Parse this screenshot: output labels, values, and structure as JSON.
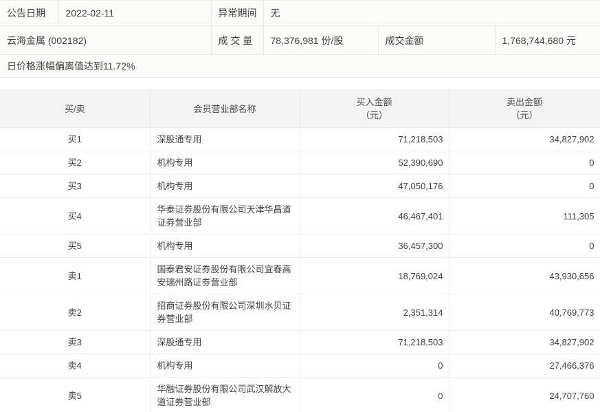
{
  "info": {
    "announce_date_label": "公告日期",
    "announce_date": "2022-02-11",
    "abnormal_period_label": "异常期间",
    "abnormal_period": "无",
    "stock_name": "云海金属 (002182)",
    "volume_label": "成 交 量",
    "volume": "78,376,981 份/股",
    "turnover_label": "成交金额",
    "turnover": "1,768,744,680 元",
    "reason": "日价格涨幅偏离值达到11.72%"
  },
  "table": {
    "columns": [
      {
        "label": "买/卖",
        "sub": ""
      },
      {
        "label": "会员营业部名称",
        "sub": ""
      },
      {
        "label": "买入金额",
        "sub": "（元）"
      },
      {
        "label": "卖出金额",
        "sub": "（元）"
      }
    ],
    "rows": [
      {
        "rank": "买1",
        "branch": "深股通专用",
        "buy": "71,218,503",
        "sell": "34,827,902"
      },
      {
        "rank": "买2",
        "branch": "机构专用",
        "buy": "52,390,690",
        "sell": "0"
      },
      {
        "rank": "买3",
        "branch": "机构专用",
        "buy": "47,050,176",
        "sell": "0"
      },
      {
        "rank": "买4",
        "branch": "华泰证券股份有限公司天津华昌道证券营业部",
        "buy": "46,467,401",
        "sell": "111,305"
      },
      {
        "rank": "买5",
        "branch": "机构专用",
        "buy": "36,457,300",
        "sell": "0"
      },
      {
        "rank": "卖1",
        "branch": "国泰君安证券股份有限公司宜春高安瑞州路证券营业部",
        "buy": "18,769,024",
        "sell": "43,930,656"
      },
      {
        "rank": "卖2",
        "branch": "招商证券股份有限公司深圳水贝证券营业部",
        "buy": "2,351,314",
        "sell": "40,769,773"
      },
      {
        "rank": "卖3",
        "branch": "深股通专用",
        "buy": "71,218,503",
        "sell": "34,827,902"
      },
      {
        "rank": "卖4",
        "branch": "机构专用",
        "buy": "0",
        "sell": "27,466,376"
      },
      {
        "rank": "卖5",
        "branch": "华融证券股份有限公司武汉解放大道证券营业部",
        "buy": "0",
        "sell": "24,707,760"
      }
    ]
  },
  "colors": {
    "header_bg": "#f4f4f5",
    "info_bg": "#fcfcfb",
    "border": "#e9e9e9",
    "text": "#404040"
  }
}
